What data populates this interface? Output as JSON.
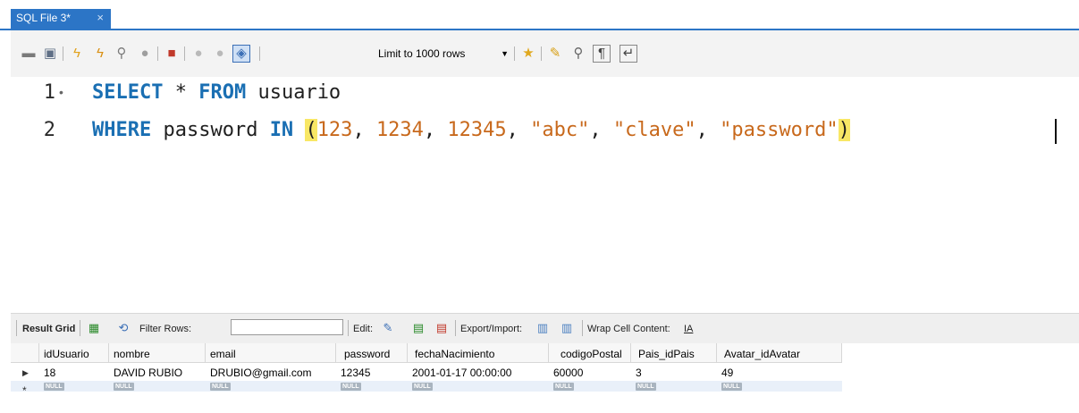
{
  "tab": {
    "title": "SQL File 3*",
    "close": "×"
  },
  "toolbar": {
    "icons": [
      "open-folder",
      "save",
      "execute",
      "execute-statement",
      "explain",
      "stop",
      "toggle-error",
      "commit",
      "rollback",
      "autocommit",
      "beautify",
      "find",
      "invisibles",
      "wrap"
    ],
    "limit_label": "Limit to 1000 rows"
  },
  "editor": {
    "lines": [
      {
        "number": "1",
        "bullet": "•"
      },
      {
        "number": "2",
        "bullet": ""
      }
    ],
    "line1": {
      "kw1": "SELECT",
      "star": " * ",
      "kw2": "FROM",
      "table": " usuario"
    },
    "line2": {
      "kw1": "WHERE",
      "col": " password ",
      "kw2": "IN",
      "space": " ",
      "open": "(",
      "close": ")",
      "values": [
        "123",
        "1234",
        "12345",
        "\"abc\"",
        "\"clave\"",
        "\"password\""
      ],
      "sep": ", "
    }
  },
  "result_toolbar": {
    "result_grid": "Result Grid",
    "filter_rows": "Filter Rows:",
    "edit": "Edit:",
    "export_import": "Export/Import:",
    "wrap_cell": "Wrap Cell Content:",
    "wrap_icon_glyph": "IA"
  },
  "grid": {
    "columns": [
      "idUsuario",
      "nombre",
      "email",
      "password",
      "fechaNacimiento",
      "codigoPostal",
      "Pais_idPais",
      "Avatar_idAvatar"
    ],
    "rows": [
      [
        "18",
        "DAVID RUBIO",
        "DRUBIO@gmail.com",
        "12345",
        "2001-01-17 00:00:00",
        "60000",
        "3",
        "49"
      ]
    ],
    "null_label": "NULL",
    "row_marker": "▶",
    "new_row_marker": "*"
  },
  "colors": {
    "tab_blue": "#2c75c6",
    "keyword": "#1a6fb3",
    "literal": "#c8691c",
    "bracket_highlight": "#f8e765"
  }
}
